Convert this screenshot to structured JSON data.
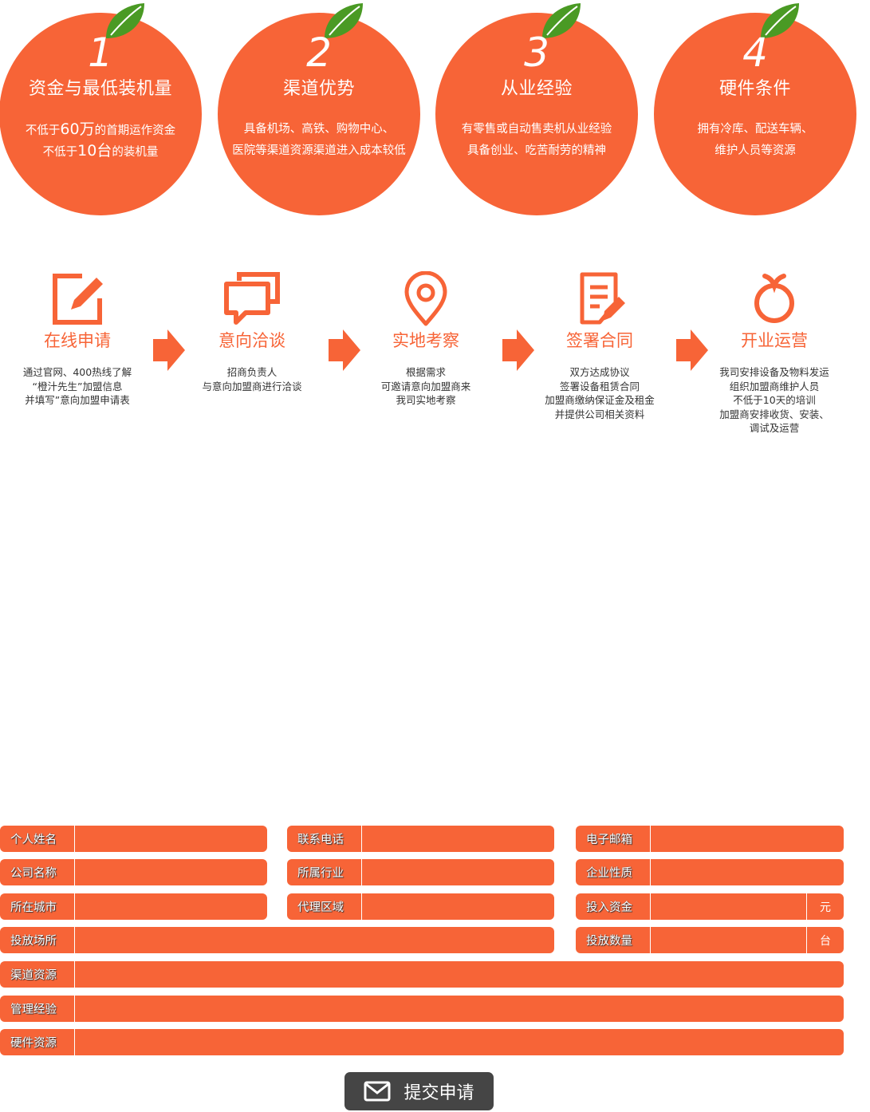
{
  "requirements": [
    {
      "num": "1",
      "title": "资金与最低装机量",
      "line1": {
        "a": "不低于",
        "b": "60万",
        "c": "的首期运作资金"
      },
      "line2": {
        "a": "不低于",
        "b": "10台",
        "c": "的装机量"
      }
    },
    {
      "num": "2",
      "title": "渠道优势",
      "line1": "具备机场、高铁、购物中心、",
      "line2": "医院等渠道资源渠道进入成本较低"
    },
    {
      "num": "3",
      "title": "从业经验",
      "line1": "有零售或自动售卖机从业经验",
      "line2": "具备创业、吃苦耐劳的精神"
    },
    {
      "num": "4",
      "title": "硬件条件",
      "line1": "拥有冷库、配送车辆、",
      "line2": "维护人员等资源"
    }
  ],
  "steps": [
    {
      "icon": "edit-icon",
      "title": "在线申请",
      "lines": [
        "通过官网、400热线了解",
        "“橙汁先生”加盟信息",
        "并填写”意向加盟申请表"
      ]
    },
    {
      "icon": "chat-icon",
      "title": "意向洽谈",
      "lines": [
        "招商负责人",
        "与意向加盟商进行洽谈"
      ]
    },
    {
      "icon": "location-pin-icon",
      "title": "实地考察",
      "lines": [
        "根据需求",
        "可邀请意向加盟商来",
        "我司实地考察"
      ]
    },
    {
      "icon": "contract-icon",
      "title": "签署合同",
      "lines": [
        "双方达成协议",
        "签署设备租赁合同",
        "加盟商缴纳保证金及租金",
        "并提供公司相关资料"
      ]
    },
    {
      "icon": "orange-icon",
      "title": "开业运营",
      "lines": [
        "我司安排设备及物料发运",
        "组织加盟商维护人员",
        "不低于10天的培训",
        "加盟商安排收货、安装、",
        "调试及运营"
      ]
    }
  ],
  "form": {
    "name": "个人姓名",
    "phone": "联系电话",
    "email": "电子邮箱",
    "company": "公司名称",
    "industry": "所属行业",
    "nature": "企业性质",
    "city": "所在城市",
    "region": "代理区域",
    "invest": "投入资金",
    "invest_unit": "元",
    "venue": "投放场所",
    "quantity": "投放数量",
    "quantity_unit": "台",
    "channel": "渠道资源",
    "experience": "管理经验",
    "hardware": "硬件资源",
    "submit": "提交申请"
  },
  "colors": {
    "accent": "#f76437",
    "leaf": "#4a9a24",
    "button": "#454545"
  }
}
